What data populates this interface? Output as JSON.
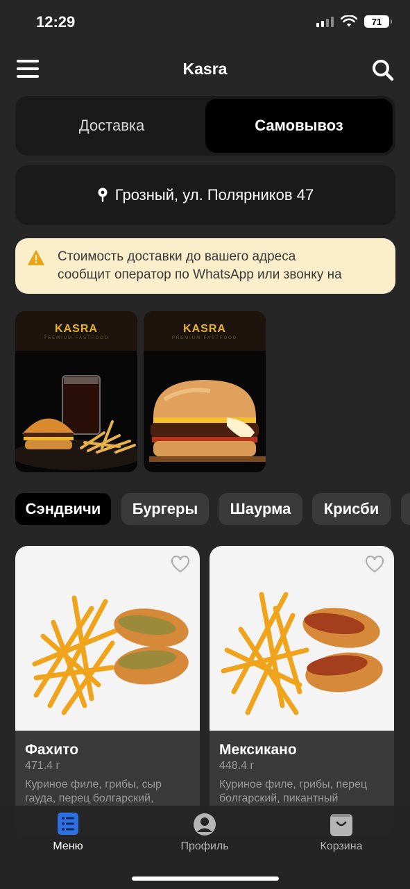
{
  "status": {
    "time": "12:29",
    "battery": "71"
  },
  "header": {
    "title": "Kasra"
  },
  "mode": {
    "delivery": "Доставка",
    "pickup": "Самовывоз"
  },
  "address": {
    "text": "Грозный, ул. Полярников 47"
  },
  "notice": {
    "text": "Стоимость доставки до вашего адреса\nсообщит оператор по WhatsApp или звонку на"
  },
  "promos": [
    {
      "logo": "KASRA",
      "sub": "PREMIUM FASTFOOD"
    },
    {
      "logo": "KASRA",
      "sub": "PREMIUM FASTFOOD"
    }
  ],
  "categories": [
    "Сэндвичи",
    "Бургеры",
    "Шаурма",
    "Крисби"
  ],
  "products": [
    {
      "name": "Фахито",
      "weight": "471.4 г",
      "description": "Куриное филе, грибы, сыр гауда, перец болгарский,",
      "filling": "#9a8a3a"
    },
    {
      "name": "Мексикано",
      "weight": "448.4 г",
      "description": "Куриное филе, грибы, перец болгарский, пикантный",
      "filling": "#a33f1c"
    }
  ],
  "tabs": {
    "menu": "Меню",
    "profile": "Профиль",
    "cart": "Корзина"
  },
  "colors": {
    "background": "#262626",
    "notice": "#fbeeca",
    "accent_tab": "#2f6fe0",
    "logo": "#e6b52b"
  }
}
